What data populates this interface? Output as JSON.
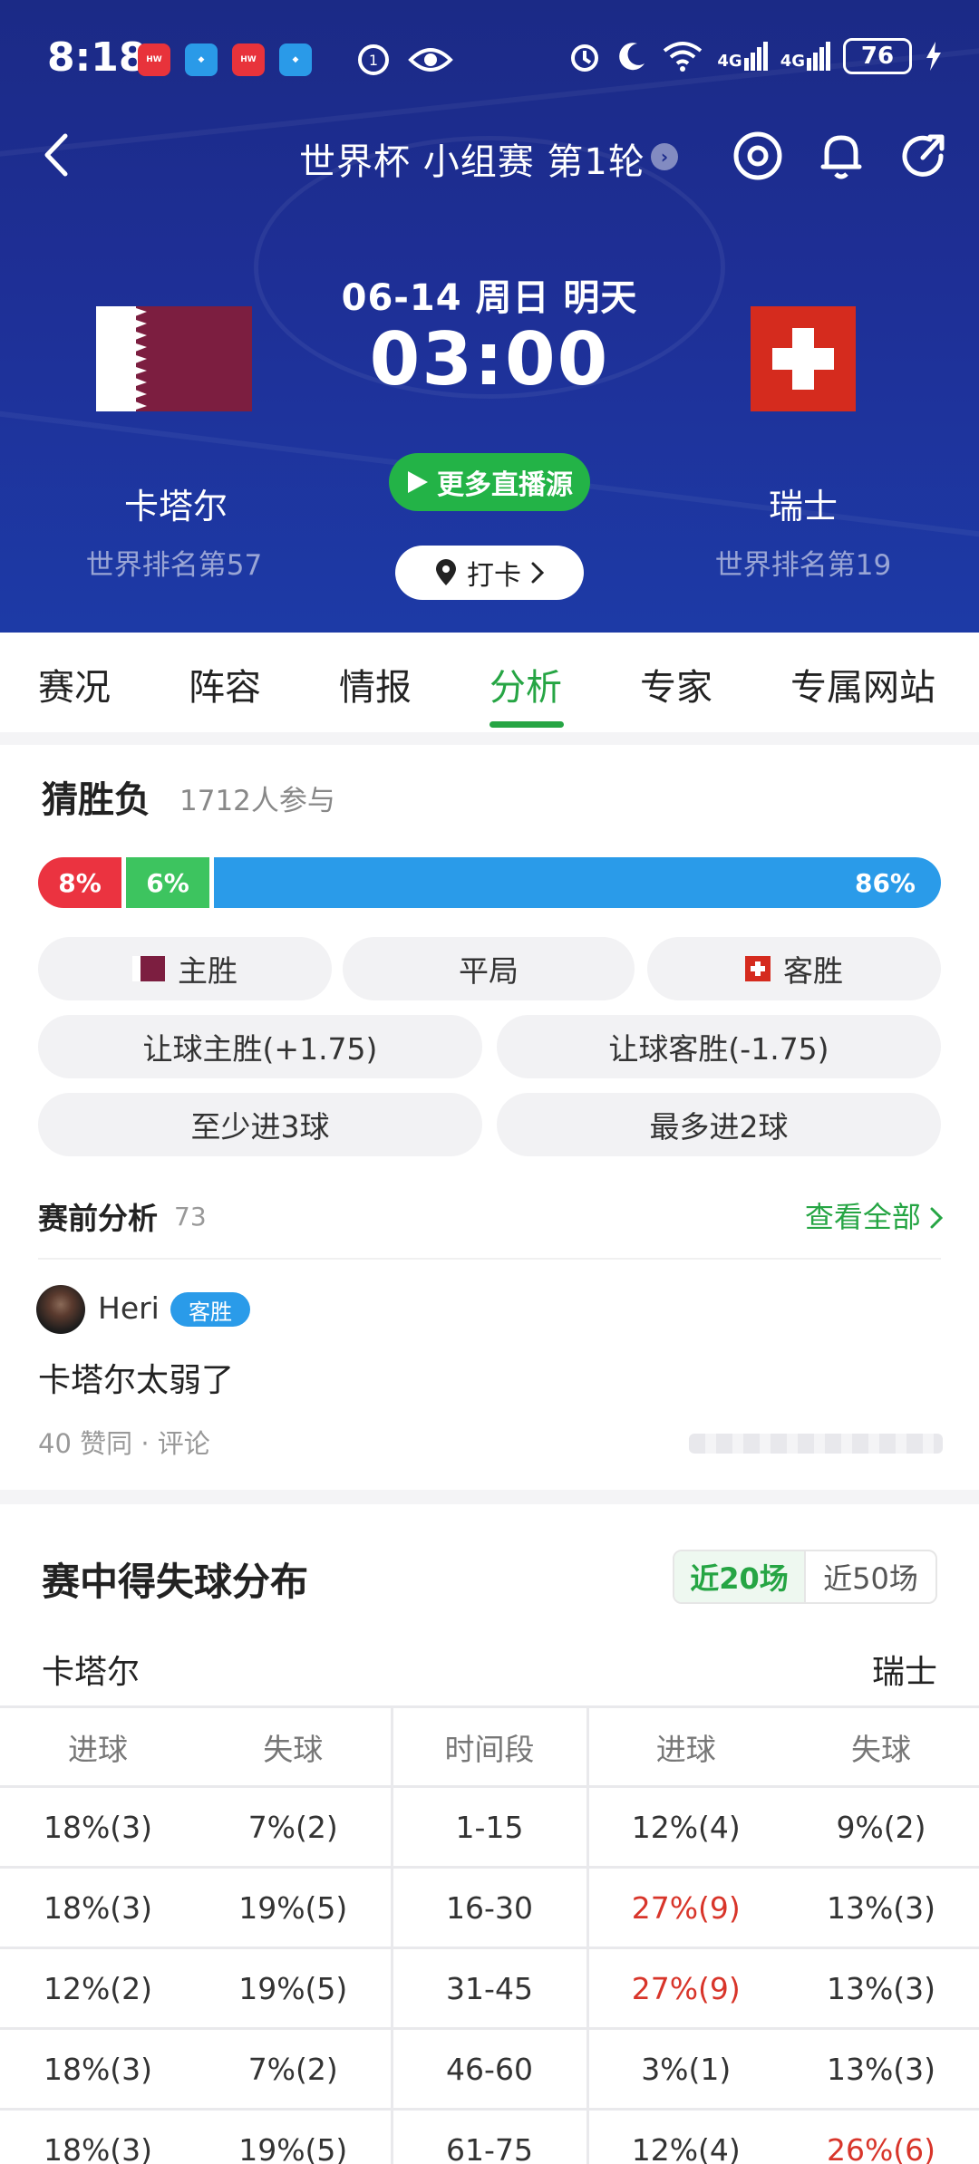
{
  "status_bar": {
    "time": "8:18",
    "battery": "76",
    "network_1": "4G",
    "network_2": "4G"
  },
  "nav": {
    "title": "世界杯 小组赛 第1轮",
    "title_chevron": "›"
  },
  "match": {
    "date": "06-14 周日 明天",
    "time": "03:00",
    "home": {
      "name": "卡塔尔",
      "rank": "世界排名第57",
      "flag_color": "#7c1e40"
    },
    "away": {
      "name": "瑞士",
      "rank": "世界排名第19",
      "flag_color": "#d52b1e"
    },
    "live_button": "更多直播源",
    "checkin_button": "打卡"
  },
  "tabs": [
    {
      "label": "赛况"
    },
    {
      "label": "阵容"
    },
    {
      "label": "情报"
    },
    {
      "label": "分析",
      "active": true
    },
    {
      "label": "专家"
    },
    {
      "label": "专属网站"
    }
  ],
  "guess": {
    "title": "猜胜负",
    "participants": "1712人参与",
    "bar": [
      {
        "label": "8%",
        "value": 8,
        "color": "#eb3340"
      },
      {
        "label": "6%",
        "value": 6,
        "color": "#3dc45f"
      },
      {
        "label": "86%",
        "value": 86,
        "color": "#2a9be9"
      }
    ],
    "options": {
      "home_win": "主胜",
      "draw": "平局",
      "away_win": "客胜",
      "handicap_home": "让球主胜(+1.75)",
      "handicap_away": "让球客胜(-1.75)",
      "at_least_3": "至少进3球",
      "at_most_2": "最多进2球"
    }
  },
  "pre_analysis": {
    "title": "赛前分析",
    "count": "73",
    "see_all": "查看全部",
    "post": {
      "user": "Heri",
      "badge": "客胜",
      "text": "卡塔尔太弱了",
      "likes": "40 赞同",
      "separator": "·",
      "comment": "评论"
    }
  },
  "distribution": {
    "title": "赛中得失球分布",
    "range_options": [
      "近20场",
      "近50场"
    ],
    "home_team": "卡塔尔",
    "away_team": "瑞士",
    "headers": [
      "进球",
      "失球",
      "时间段",
      "进球",
      "失球"
    ],
    "rows": [
      {
        "h_for": "18%(3)",
        "h_against": "7%(2)",
        "period": "1-15",
        "a_for": "12%(4)",
        "a_against": "9%(2)"
      },
      {
        "h_for": "18%(3)",
        "h_against": "19%(5)",
        "period": "16-30",
        "a_for": "27%(9)",
        "a_against": "13%(3)"
      },
      {
        "h_for": "12%(2)",
        "h_against": "19%(5)",
        "period": "31-45",
        "a_for": "27%(9)",
        "a_against": "13%(3)"
      },
      {
        "h_for": "18%(3)",
        "h_against": "7%(2)",
        "period": "46-60",
        "a_for": "3%(1)",
        "a_against": "13%(3)"
      },
      {
        "h_for": "18%(3)",
        "h_against": "19%(5)",
        "period": "61-75",
        "a_for": "12%(4)",
        "a_against": "26%(6)"
      }
    ],
    "highlight_color": "#d8352a"
  }
}
